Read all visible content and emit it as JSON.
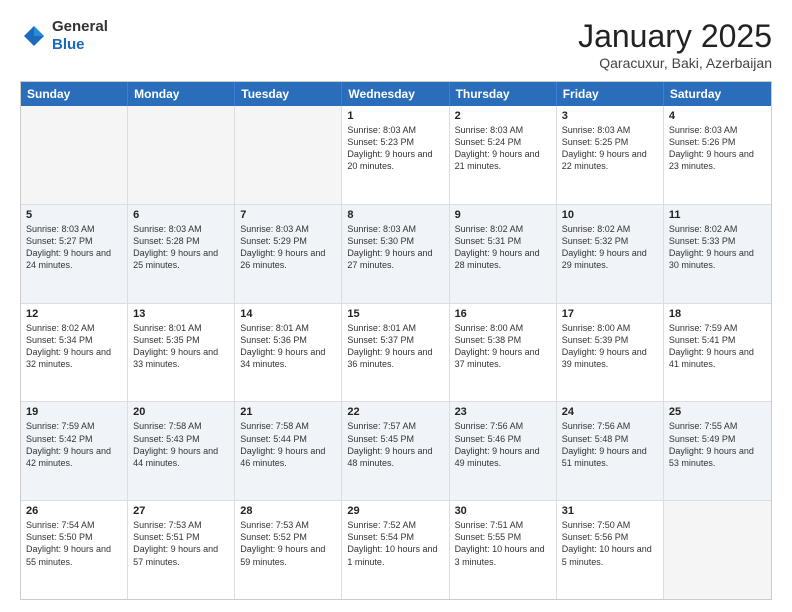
{
  "logo": {
    "general": "General",
    "blue": "Blue"
  },
  "title": "January 2025",
  "location": "Qaracuxur, Baki, Azerbaijan",
  "weekdays": [
    "Sunday",
    "Monday",
    "Tuesday",
    "Wednesday",
    "Thursday",
    "Friday",
    "Saturday"
  ],
  "rows": [
    [
      {
        "day": "",
        "sunrise": "",
        "sunset": "",
        "daylight": "",
        "empty": true
      },
      {
        "day": "",
        "sunrise": "",
        "sunset": "",
        "daylight": "",
        "empty": true
      },
      {
        "day": "",
        "sunrise": "",
        "sunset": "",
        "daylight": "",
        "empty": true
      },
      {
        "day": "1",
        "sunrise": "Sunrise: 8:03 AM",
        "sunset": "Sunset: 5:23 PM",
        "daylight": "Daylight: 9 hours and 20 minutes."
      },
      {
        "day": "2",
        "sunrise": "Sunrise: 8:03 AM",
        "sunset": "Sunset: 5:24 PM",
        "daylight": "Daylight: 9 hours and 21 minutes."
      },
      {
        "day": "3",
        "sunrise": "Sunrise: 8:03 AM",
        "sunset": "Sunset: 5:25 PM",
        "daylight": "Daylight: 9 hours and 22 minutes."
      },
      {
        "day": "4",
        "sunrise": "Sunrise: 8:03 AM",
        "sunset": "Sunset: 5:26 PM",
        "daylight": "Daylight: 9 hours and 23 minutes."
      }
    ],
    [
      {
        "day": "5",
        "sunrise": "Sunrise: 8:03 AM",
        "sunset": "Sunset: 5:27 PM",
        "daylight": "Daylight: 9 hours and 24 minutes."
      },
      {
        "day": "6",
        "sunrise": "Sunrise: 8:03 AM",
        "sunset": "Sunset: 5:28 PM",
        "daylight": "Daylight: 9 hours and 25 minutes."
      },
      {
        "day": "7",
        "sunrise": "Sunrise: 8:03 AM",
        "sunset": "Sunset: 5:29 PM",
        "daylight": "Daylight: 9 hours and 26 minutes."
      },
      {
        "day": "8",
        "sunrise": "Sunrise: 8:03 AM",
        "sunset": "Sunset: 5:30 PM",
        "daylight": "Daylight: 9 hours and 27 minutes."
      },
      {
        "day": "9",
        "sunrise": "Sunrise: 8:02 AM",
        "sunset": "Sunset: 5:31 PM",
        "daylight": "Daylight: 9 hours and 28 minutes."
      },
      {
        "day": "10",
        "sunrise": "Sunrise: 8:02 AM",
        "sunset": "Sunset: 5:32 PM",
        "daylight": "Daylight: 9 hours and 29 minutes."
      },
      {
        "day": "11",
        "sunrise": "Sunrise: 8:02 AM",
        "sunset": "Sunset: 5:33 PM",
        "daylight": "Daylight: 9 hours and 30 minutes."
      }
    ],
    [
      {
        "day": "12",
        "sunrise": "Sunrise: 8:02 AM",
        "sunset": "Sunset: 5:34 PM",
        "daylight": "Daylight: 9 hours and 32 minutes."
      },
      {
        "day": "13",
        "sunrise": "Sunrise: 8:01 AM",
        "sunset": "Sunset: 5:35 PM",
        "daylight": "Daylight: 9 hours and 33 minutes."
      },
      {
        "day": "14",
        "sunrise": "Sunrise: 8:01 AM",
        "sunset": "Sunset: 5:36 PM",
        "daylight": "Daylight: 9 hours and 34 minutes."
      },
      {
        "day": "15",
        "sunrise": "Sunrise: 8:01 AM",
        "sunset": "Sunset: 5:37 PM",
        "daylight": "Daylight: 9 hours and 36 minutes."
      },
      {
        "day": "16",
        "sunrise": "Sunrise: 8:00 AM",
        "sunset": "Sunset: 5:38 PM",
        "daylight": "Daylight: 9 hours and 37 minutes."
      },
      {
        "day": "17",
        "sunrise": "Sunrise: 8:00 AM",
        "sunset": "Sunset: 5:39 PM",
        "daylight": "Daylight: 9 hours and 39 minutes."
      },
      {
        "day": "18",
        "sunrise": "Sunrise: 7:59 AM",
        "sunset": "Sunset: 5:41 PM",
        "daylight": "Daylight: 9 hours and 41 minutes."
      }
    ],
    [
      {
        "day": "19",
        "sunrise": "Sunrise: 7:59 AM",
        "sunset": "Sunset: 5:42 PM",
        "daylight": "Daylight: 9 hours and 42 minutes."
      },
      {
        "day": "20",
        "sunrise": "Sunrise: 7:58 AM",
        "sunset": "Sunset: 5:43 PM",
        "daylight": "Daylight: 9 hours and 44 minutes."
      },
      {
        "day": "21",
        "sunrise": "Sunrise: 7:58 AM",
        "sunset": "Sunset: 5:44 PM",
        "daylight": "Daylight: 9 hours and 46 minutes."
      },
      {
        "day": "22",
        "sunrise": "Sunrise: 7:57 AM",
        "sunset": "Sunset: 5:45 PM",
        "daylight": "Daylight: 9 hours and 48 minutes."
      },
      {
        "day": "23",
        "sunrise": "Sunrise: 7:56 AM",
        "sunset": "Sunset: 5:46 PM",
        "daylight": "Daylight: 9 hours and 49 minutes."
      },
      {
        "day": "24",
        "sunrise": "Sunrise: 7:56 AM",
        "sunset": "Sunset: 5:48 PM",
        "daylight": "Daylight: 9 hours and 51 minutes."
      },
      {
        "day": "25",
        "sunrise": "Sunrise: 7:55 AM",
        "sunset": "Sunset: 5:49 PM",
        "daylight": "Daylight: 9 hours and 53 minutes."
      }
    ],
    [
      {
        "day": "26",
        "sunrise": "Sunrise: 7:54 AM",
        "sunset": "Sunset: 5:50 PM",
        "daylight": "Daylight: 9 hours and 55 minutes."
      },
      {
        "day": "27",
        "sunrise": "Sunrise: 7:53 AM",
        "sunset": "Sunset: 5:51 PM",
        "daylight": "Daylight: 9 hours and 57 minutes."
      },
      {
        "day": "28",
        "sunrise": "Sunrise: 7:53 AM",
        "sunset": "Sunset: 5:52 PM",
        "daylight": "Daylight: 9 hours and 59 minutes."
      },
      {
        "day": "29",
        "sunrise": "Sunrise: 7:52 AM",
        "sunset": "Sunset: 5:54 PM",
        "daylight": "Daylight: 10 hours and 1 minute."
      },
      {
        "day": "30",
        "sunrise": "Sunrise: 7:51 AM",
        "sunset": "Sunset: 5:55 PM",
        "daylight": "Daylight: 10 hours and 3 minutes."
      },
      {
        "day": "31",
        "sunrise": "Sunrise: 7:50 AM",
        "sunset": "Sunset: 5:56 PM",
        "daylight": "Daylight: 10 hours and 5 minutes."
      },
      {
        "day": "",
        "sunrise": "",
        "sunset": "",
        "daylight": "",
        "empty": true
      }
    ]
  ]
}
